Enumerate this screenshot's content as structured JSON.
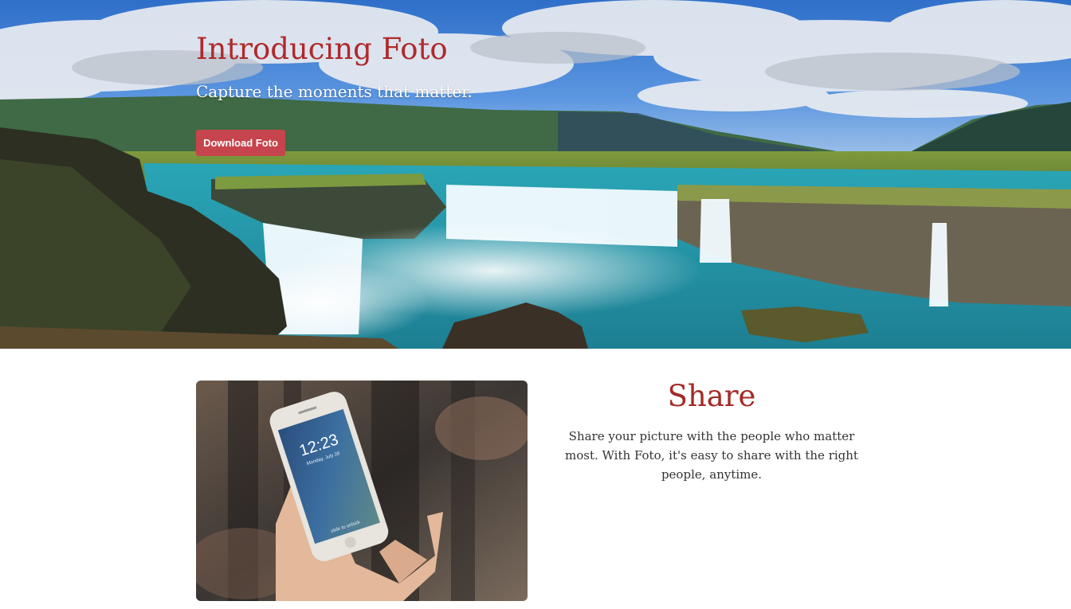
{
  "hero": {
    "title": "Introducing Foto",
    "subtitle": "Capture the moments that matter.",
    "download_label": "Download Foto",
    "image": "waterfall-landscape-photo"
  },
  "share": {
    "heading": "Share",
    "description": "Share your picture with the people who matter most. With Foto, it's easy to share with the right people, anytime.",
    "image": "hand-holding-smartphone-photo",
    "phone_time": "12:23",
    "phone_date": "Monday, July 28",
    "phone_unlock_text": "slide to unlock"
  },
  "colors": {
    "accent": "#b0292a",
    "button": "#c6444d",
    "body_text": "#333333"
  }
}
